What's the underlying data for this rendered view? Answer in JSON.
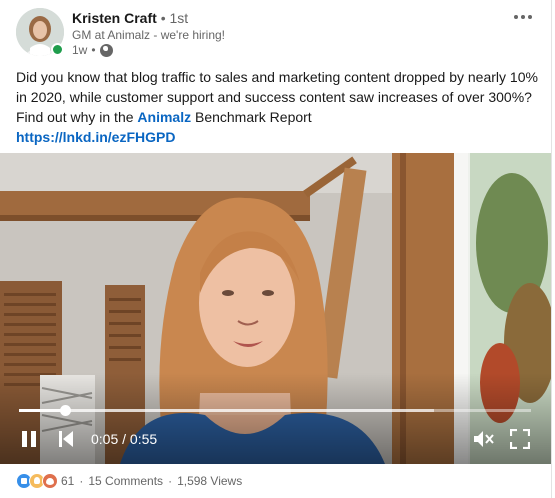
{
  "author": {
    "name": "Kristen Craft",
    "degree_separator": "•",
    "degree": "1st",
    "headline": "GM at Animalz - we're hiring!",
    "posted": "1w",
    "meta_separator": "•",
    "visibility_icon": "globe-icon",
    "presence": "online"
  },
  "post": {
    "text_before": "Did you know that blog traffic to sales and marketing content dropped by nearly 10% in 2020, while customer support and success content saw increases of over 300%? Find out why in the ",
    "mention": "Animalz",
    "text_after": " Benchmark Report",
    "link": "https://lnkd.in/ezFHGPD"
  },
  "video": {
    "current_time": "0:05",
    "separator": " / ",
    "duration": "0:55",
    "progress_fraction": 0.09,
    "buffered_fraction": 0.81,
    "controls": [
      "pause-icon",
      "skip-back-icon",
      "volume-muted-icon",
      "fullscreen-icon"
    ]
  },
  "social": {
    "reaction_icons": [
      "like-reaction-icon",
      "insightful-reaction-icon",
      "love-reaction-icon"
    ],
    "reactions_count": "61",
    "separator": "·",
    "comments": "15 Comments",
    "separator2": "·",
    "views": "1,598 Views"
  },
  "colors": {
    "brand_link": "#0a66c2",
    "presence_green": "#1f9d4c",
    "like_blue": "#378fe9",
    "insight_yellow": "#f5bb5c",
    "love_orange": "#df704d"
  }
}
